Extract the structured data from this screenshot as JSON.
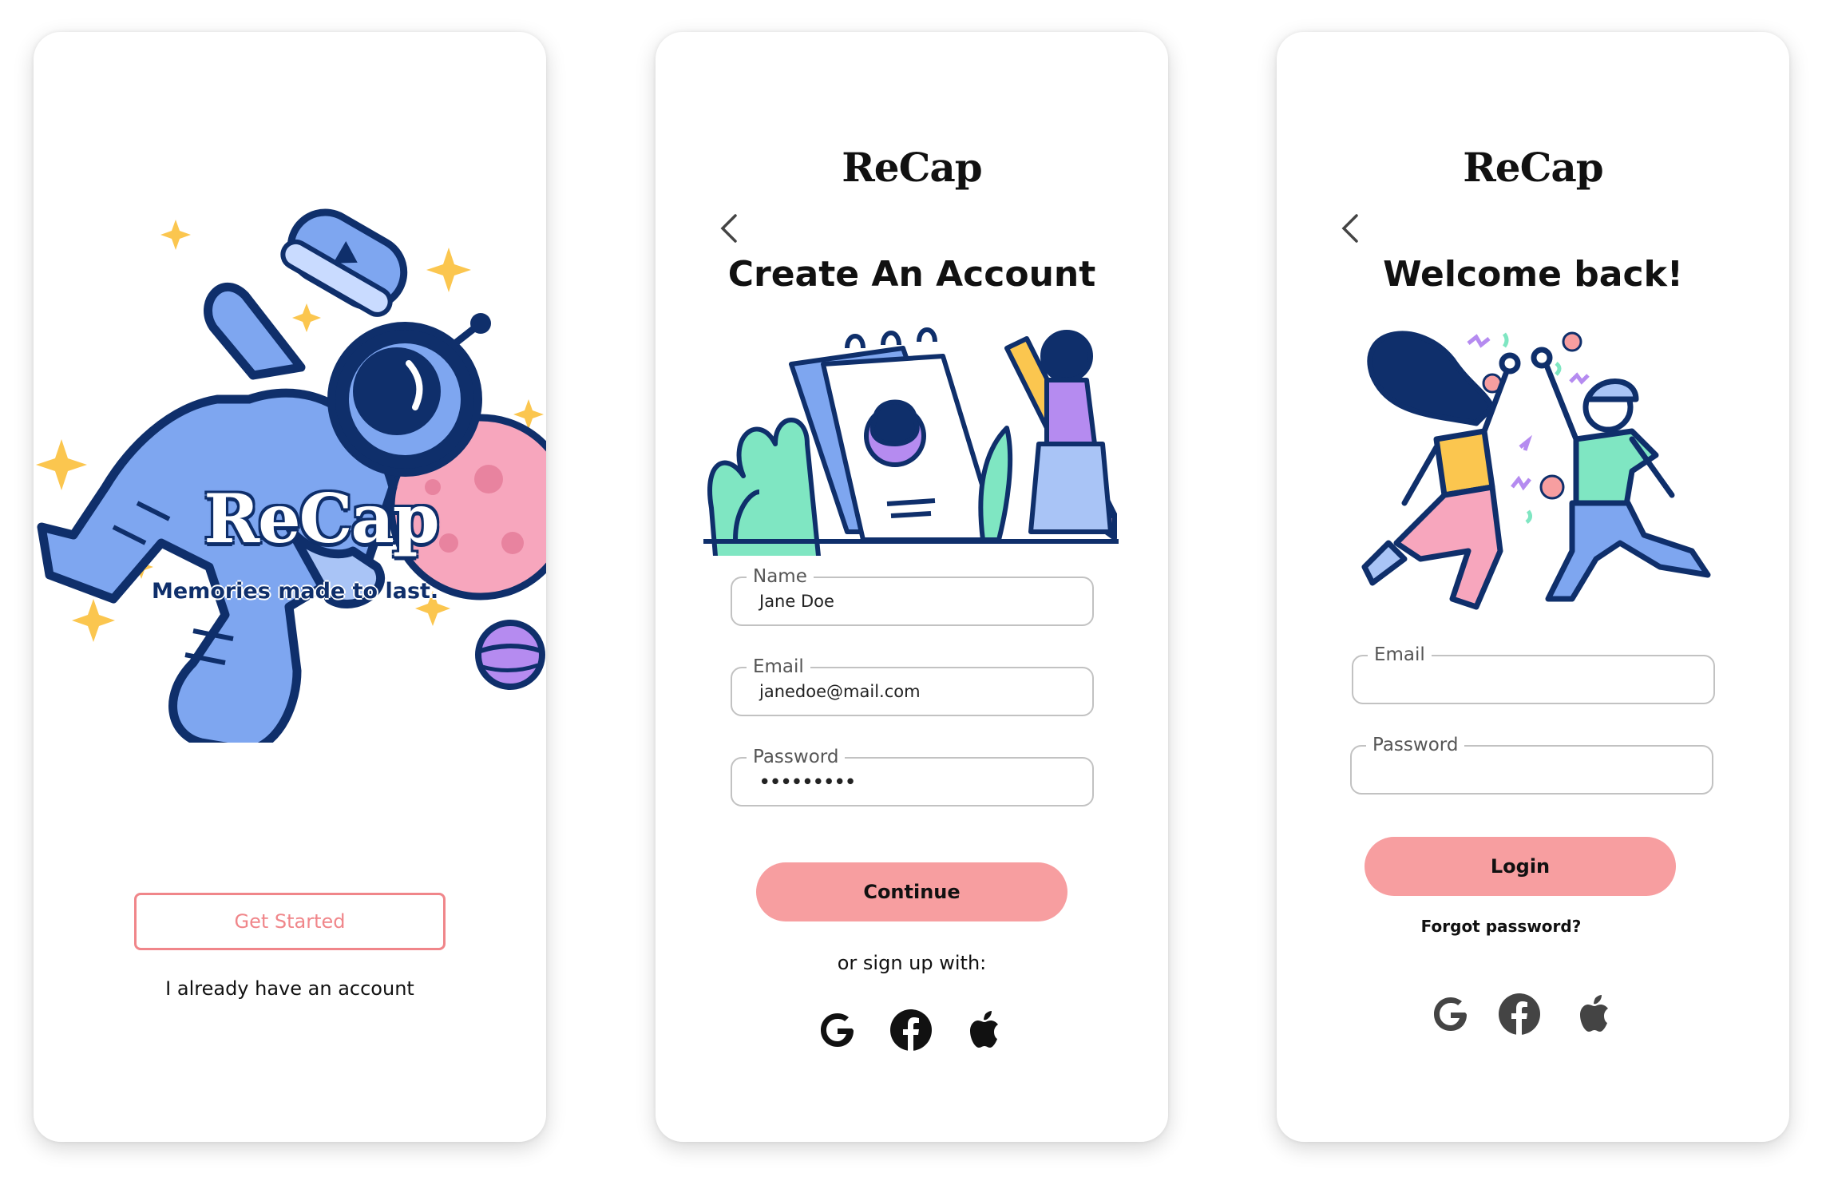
{
  "welcome": {
    "brand": "ReCap",
    "tagline": "Memories made to last.",
    "get_started": "Get Started",
    "have_account": "I already have an account"
  },
  "signup": {
    "brand": "ReCap",
    "title": "Create An Account",
    "fields": [
      {
        "label": "Name",
        "value": "Jane Doe"
      },
      {
        "label": "Email",
        "value": "janedoe@mail.com"
      },
      {
        "label": "Password",
        "value": "•••••••••"
      }
    ],
    "continue": "Continue",
    "or_signup": "or sign up with:"
  },
  "login": {
    "brand": "ReCap",
    "title": "Welcome back!",
    "fields": [
      {
        "label": "Email",
        "value": ""
      },
      {
        "label": "Password",
        "value": ""
      }
    ],
    "login": "Login",
    "forgot": "Forgot password?"
  },
  "social_icons": [
    "google-icon",
    "facebook-icon",
    "apple-icon"
  ],
  "colors": {
    "accent_pink": "#f79ea0",
    "outline_pink": "#f0868a",
    "navy": "#0f2f6b",
    "astronaut_blue": "#7ea6f0",
    "mint": "#7fe6c2",
    "purple": "#b58bf0",
    "yellow": "#fbc64f"
  }
}
